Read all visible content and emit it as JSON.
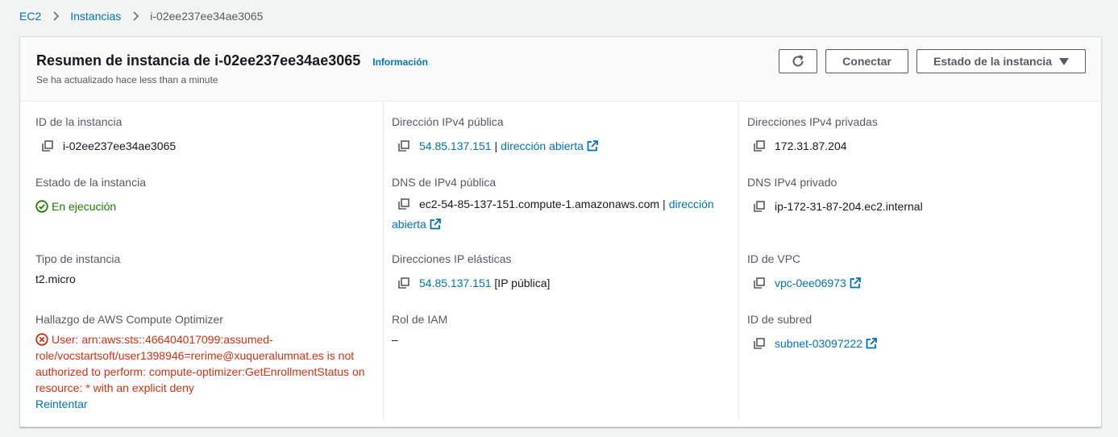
{
  "breadcrumb": {
    "items": [
      "EC2",
      "Instancias"
    ],
    "current": "i-02ee237ee34ae3065"
  },
  "header": {
    "title": "Resumen de instancia de i-02ee237ee34ae3065",
    "info_link": "Información",
    "subtitle": "Se ha actualizado hace less than a minute",
    "connect_label": "Conectar",
    "instance_state_label": "Estado de la instancia"
  },
  "details": {
    "instance_id": {
      "label": "ID de la instancia",
      "value": "i-02ee237ee34ae3065"
    },
    "instance_state": {
      "label": "Estado de la instancia",
      "value": "En ejecución"
    },
    "instance_type": {
      "label": "Tipo de instancia",
      "value": "t2.micro"
    },
    "optimizer": {
      "label": "Hallazgo de AWS Compute Optimizer",
      "error": "User: arn:aws:sts::466404017099:assumed-role/vocstartsoft/user1398946=rerime@xuqueralumnat.es is not authorized to perform: compute-optimizer:GetEnrollmentStatus on resource: * with an explicit deny",
      "retry": "Reintentar"
    },
    "public_ipv4": {
      "label": "Dirección IPv4 pública",
      "value": "54.85.137.151",
      "link": "dirección abierta"
    },
    "public_dns": {
      "label": "DNS de IPv4 pública",
      "value": "ec2-54-85-137-151.compute-1.amazonaws.com",
      "link_part1": "dirección",
      "link_part2": "abierta"
    },
    "elastic_ips": {
      "label": "Direcciones IP elásticas",
      "value": "54.85.137.151",
      "suffix": "[IP pública]"
    },
    "iam_role": {
      "label": "Rol de IAM",
      "value": "–"
    },
    "private_ipv4": {
      "label": "Direcciones IPv4 privadas",
      "value": "172.31.87.204"
    },
    "private_dns": {
      "label": "DNS IPv4 privado",
      "value": "ip-172-31-87-204.ec2.internal"
    },
    "vpc_id": {
      "label": "ID de VPC",
      "value": "vpc-0ee06973"
    },
    "subnet_id": {
      "label": "ID de subred",
      "value": "subnet-03097222"
    }
  },
  "colors": {
    "link": "#0073bb",
    "success": "#1d8102",
    "error": "#d13212",
    "label": "#545b64"
  }
}
